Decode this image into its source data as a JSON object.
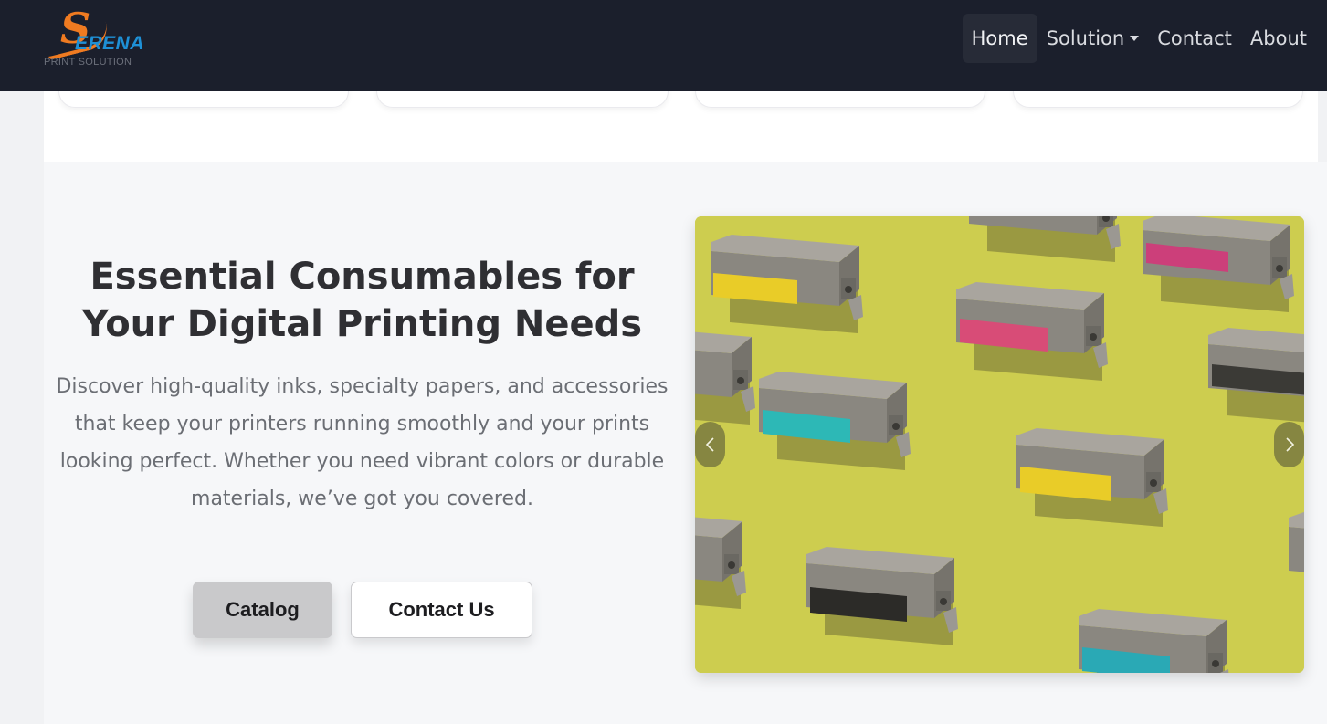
{
  "brand": {
    "logo_initial": "S",
    "logo_word": "ERENA",
    "logo_sub": "PRINT SOLUTION",
    "colors": {
      "orange": "#f07b21",
      "blue": "#1e90d6",
      "navbar_bg": "#1b1f2c"
    }
  },
  "nav": {
    "items": [
      {
        "label": "Home",
        "active": true
      },
      {
        "label": "Solution",
        "has_dropdown": true
      },
      {
        "label": "Contact"
      },
      {
        "label": "About"
      }
    ]
  },
  "hero": {
    "title": "Essential Consumables for Your Digital Printing Needs",
    "description": "Discover high-quality inks, specialty papers, and accessories that keep your printers running smoothly and your prints looking perfect. Whether you need vibrant colors or durable materials, we’ve got you covered.",
    "buttons": {
      "catalog": "Catalog",
      "contact": "Contact Us"
    }
  },
  "carousel": {
    "image_subject": "ink cartridges on yellow background",
    "background_color": "#cdcd4f",
    "prev_icon": "chevron-left-icon",
    "next_icon": "chevron-right-icon"
  }
}
